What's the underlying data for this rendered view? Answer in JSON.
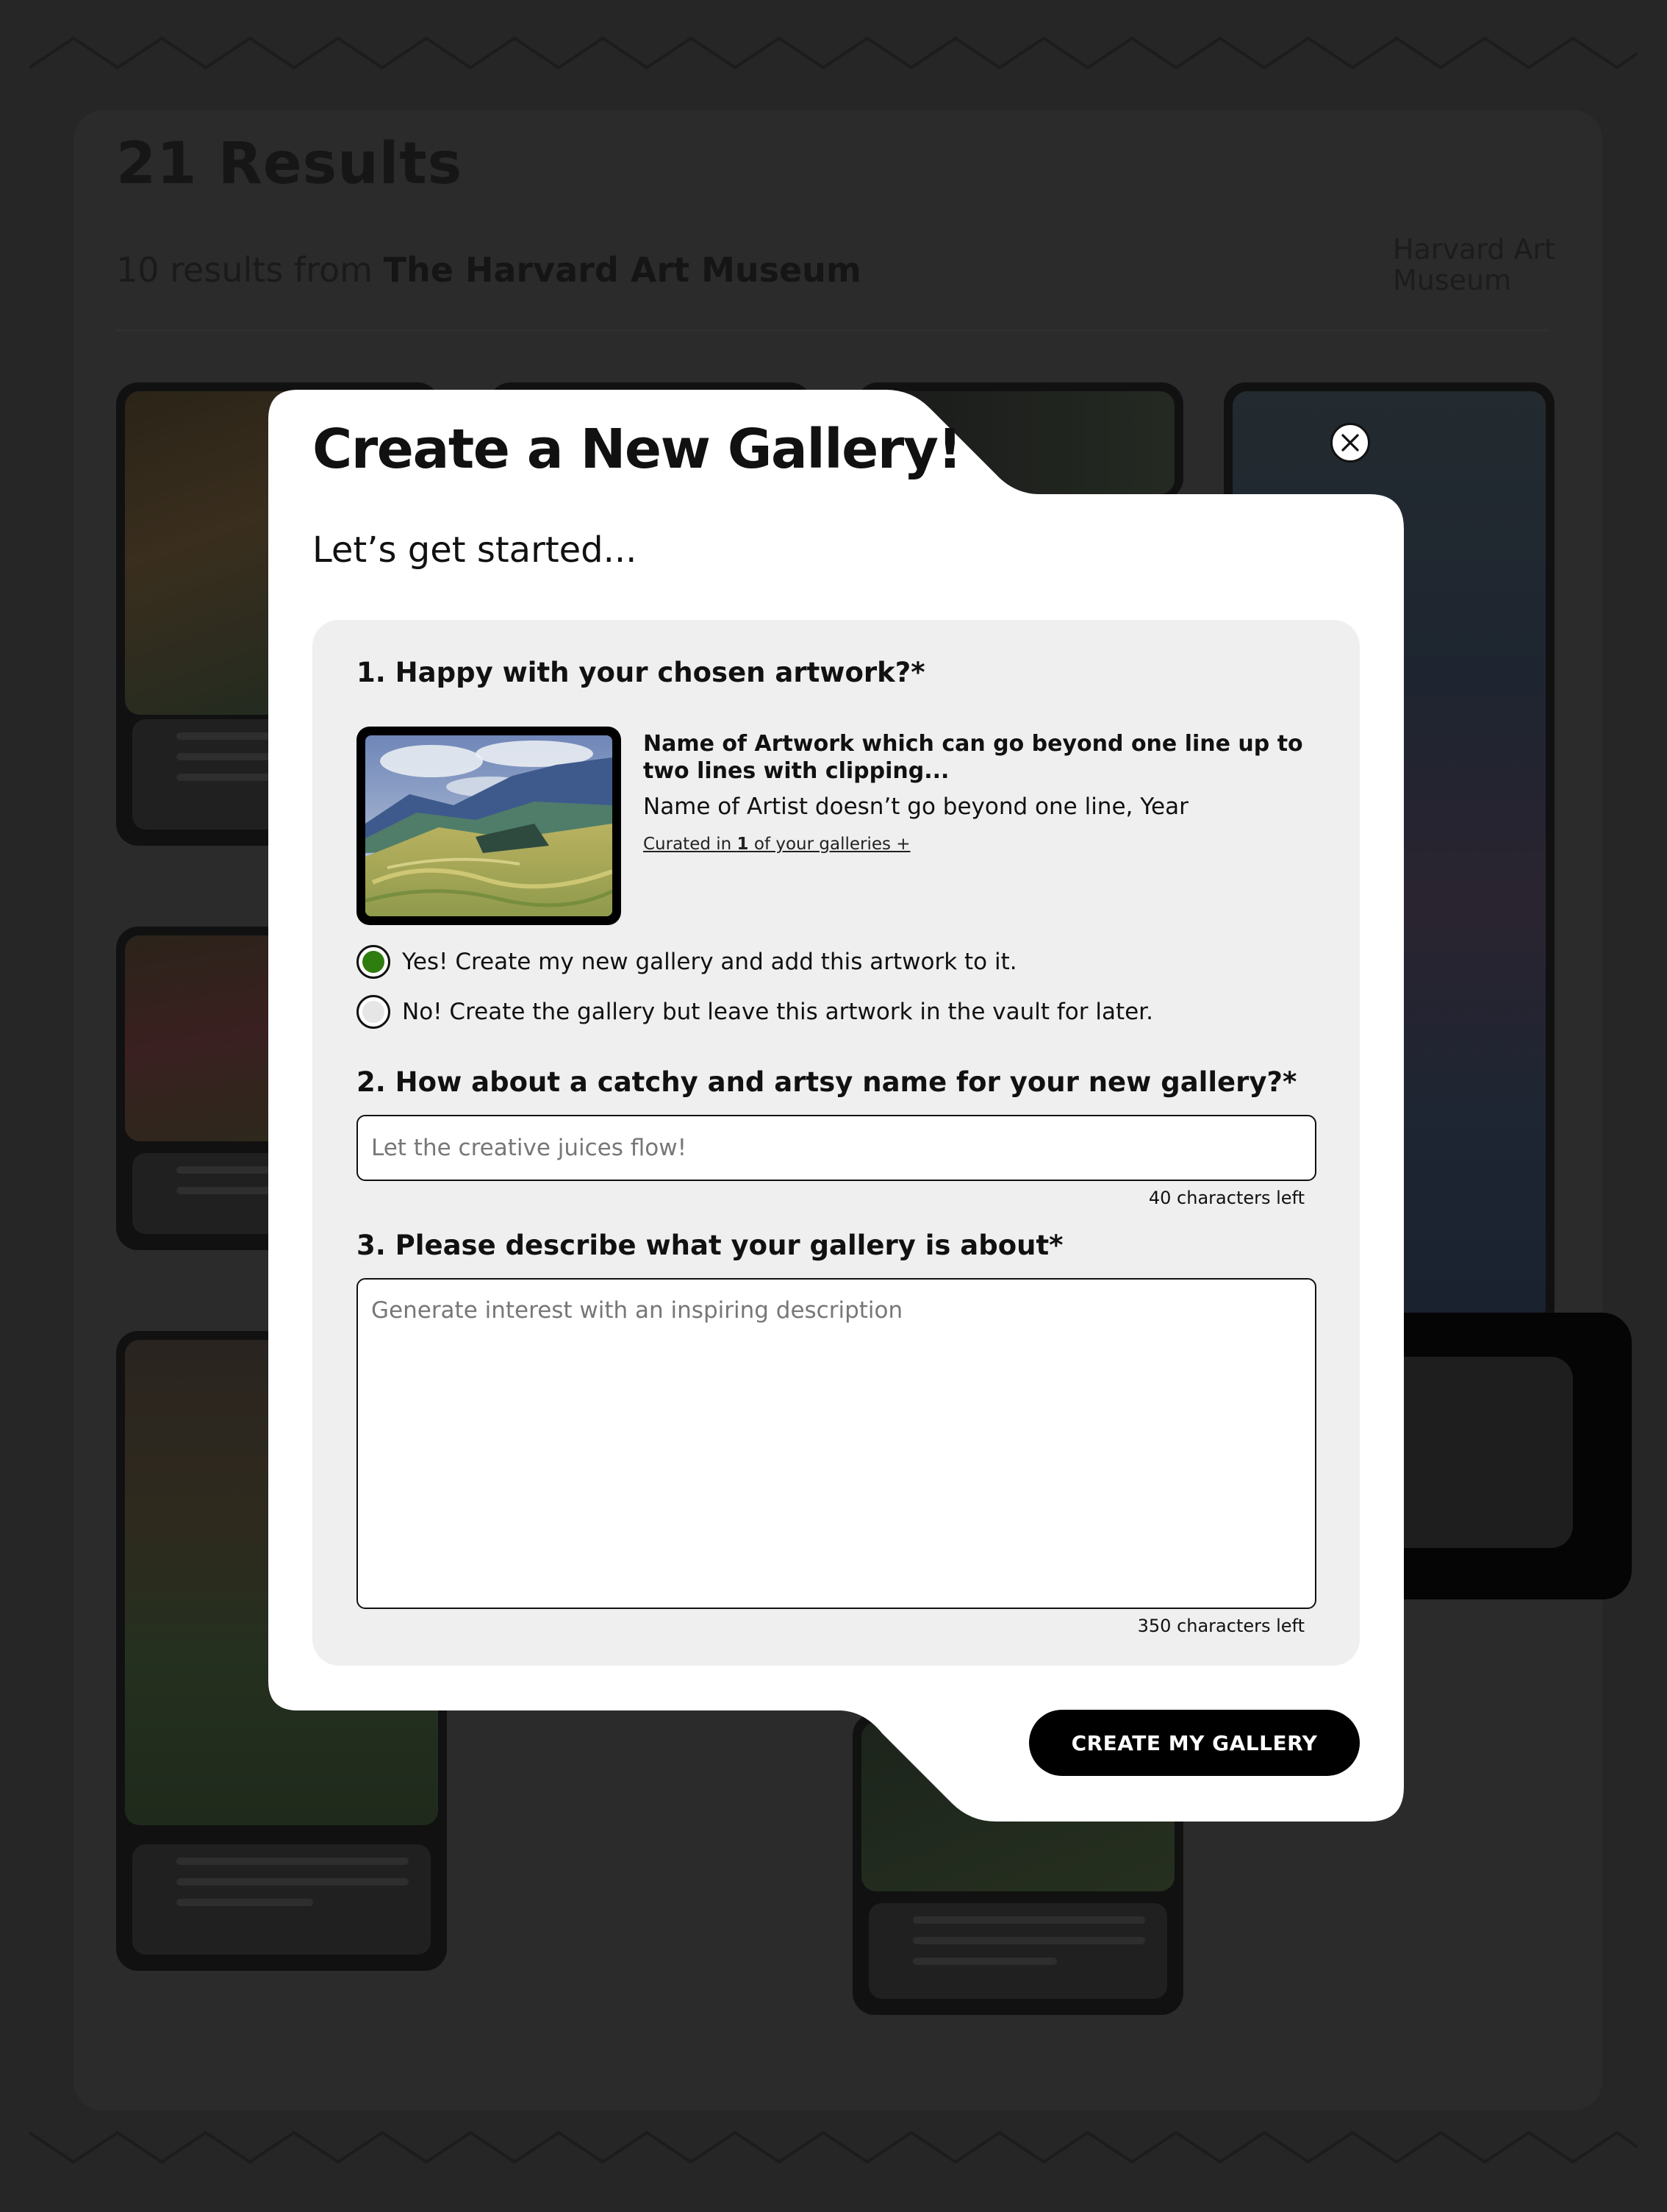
{
  "background": {
    "results_title": "21 Results",
    "results_count_text": "10 results from ",
    "results_source": "The Harvard Art Museum",
    "source_filter": "Harvard Art Museum"
  },
  "modal": {
    "title": "Create a New Gallery!",
    "subtitle": "Let’s get started...",
    "close_icon": "close-icon",
    "question1": {
      "label": "1. Happy with your chosen artwork?*",
      "artwork_name": "Name of Artwork which can go beyond one line up to two lines with clipping...",
      "artist_year": "Name of Artist doesn’t go beyond one line, Year",
      "curated_prefix": "Curated in ",
      "curated_count": "1",
      "curated_suffix": " of your galleries +",
      "options": [
        {
          "label": "Yes! Create my new gallery and add this artwork to it.",
          "selected": true
        },
        {
          "label": "No! Create the gallery but leave this artwork in the vault for later.",
          "selected": false
        }
      ]
    },
    "question2": {
      "label": "2. How about a catchy and artsy name for your new gallery?*",
      "value": "",
      "placeholder": "Let the creative juices flow!",
      "counter": "40 characters left"
    },
    "question3": {
      "label": "3. Please describe what your gallery is about*",
      "value": "",
      "placeholder": "Generate interest with an inspiring description",
      "counter": "350 characters left"
    },
    "submit_label": "CREATE MY GALLERY"
  },
  "colors": {
    "selected_radio": "#2e7d0f",
    "unselected_radio": "#e6e6e6",
    "overlay": "#262626",
    "button": "#000000"
  }
}
